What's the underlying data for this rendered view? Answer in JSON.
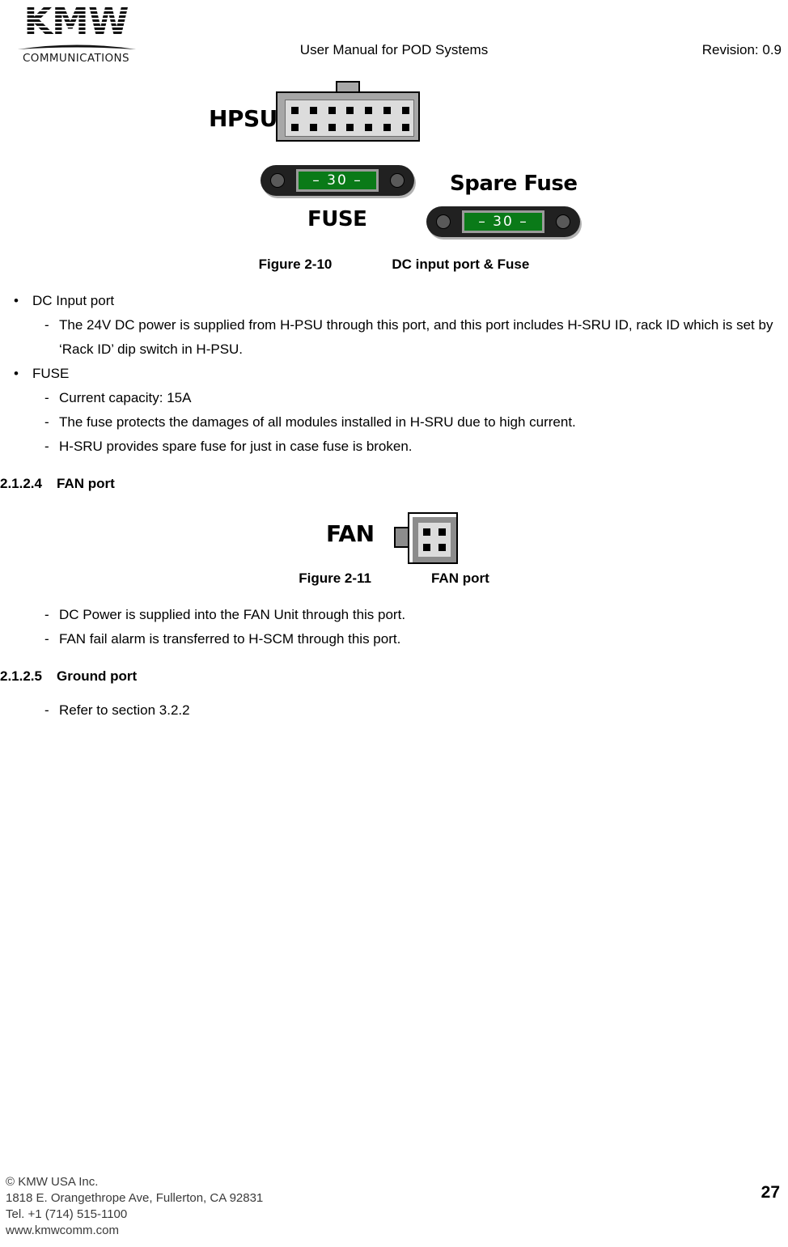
{
  "header": {
    "logo_text": "KMW",
    "logo_subtitle": "COMMUNICATIONS",
    "title": "User Manual for POD Systems",
    "revision": "Revision: 0.9"
  },
  "figure_2_10": {
    "hpsu_label": "HPSU",
    "fuse_label": "FUSE",
    "spare_fuse_label": "Spare Fuse",
    "fuse_rating_text": "– 30 –",
    "spare_fuse_rating_text": "– 30 –",
    "caption_number": "Figure 2-10",
    "caption_text": "DC input port & Fuse",
    "hpsu_pin_count_per_row": 7
  },
  "section_dc_input": {
    "bullet": "DC Input port",
    "marker_bullet": "•",
    "marker_dash": "-",
    "detail": "The 24V DC power is supplied from H-PSU through this port, and this port includes H-SRU ID, rack ID which is set by ‘Rack ID’ dip switch in H-PSU."
  },
  "section_fuse": {
    "bullet": "FUSE",
    "marker_bullet": "•",
    "marker_dash": "-",
    "details": [
      "Current capacity: 15A",
      "The fuse protects the damages of all modules installed in H-SRU due to high current.",
      "H-SRU provides spare fuse for just in case fuse is broken."
    ]
  },
  "section_fan_port": {
    "number": "2.1.2.4",
    "title": "FAN port",
    "marker_dash": "-",
    "details": [
      "DC Power is supplied into the FAN Unit through this port.",
      "FAN fail alarm is transferred to H-SCM through this port."
    ]
  },
  "figure_2_11": {
    "fan_label": "FAN",
    "caption_number": "Figure 2-11",
    "caption_text": "FAN port"
  },
  "section_ground_port": {
    "number": "2.1.2.5",
    "title": "Ground port",
    "marker_dash": "-",
    "detail": "Refer to section 3.2.2"
  },
  "footer": {
    "line1": "© KMW USA Inc.",
    "line2": "1818 E. Orangethrope Ave, Fullerton, CA 92831",
    "line3": "Tel. +1 (714) 515-1100",
    "line4": "www.kmwcomm.com",
    "page_number": "27"
  },
  "colors": {
    "fuse_window_green": "#0a7a18",
    "fuse_body": "#212121",
    "connector_frame": "#a7a7a7",
    "connector_inner": "#dcdcdc",
    "pin": "#000000"
  }
}
